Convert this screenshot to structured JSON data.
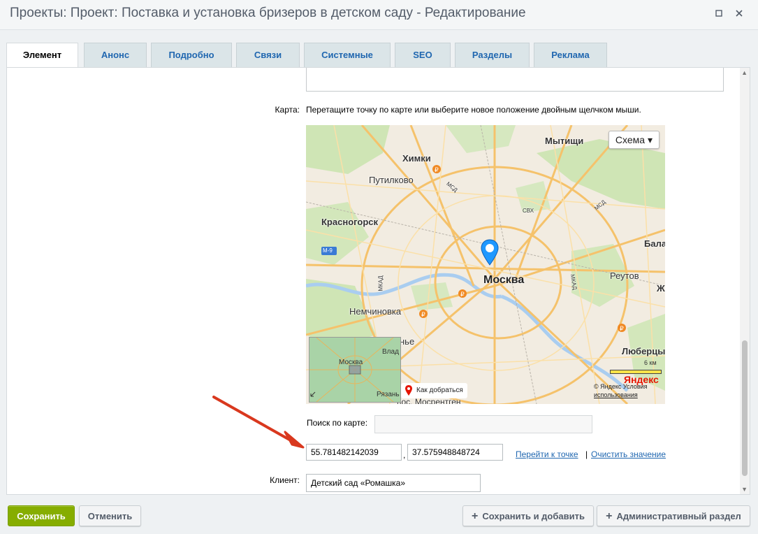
{
  "window": {
    "title": "Проекты: Проект: Поставка и установка бризеров в детском саду - Редактирование",
    "maximize_icon": "maximize-icon",
    "close_icon": "close-icon"
  },
  "tabs": [
    {
      "label": "Элемент",
      "active": true
    },
    {
      "label": "Анонс"
    },
    {
      "label": "Подробно"
    },
    {
      "label": "Связи"
    },
    {
      "label": "Системные"
    },
    {
      "label": "SEO"
    },
    {
      "label": "Разделы"
    },
    {
      "label": "Реклама"
    }
  ],
  "map_field": {
    "label": "Карта:",
    "hint": "Перетащите точку по карте или выберите новое положение двойным щелчком мыши."
  },
  "map": {
    "type_button": "Схема ▾",
    "labels": {
      "khimki": "Химки",
      "mytishchi": "Мытищи",
      "putilkovo": "Путилково",
      "krasnogorsk": "Красногорск",
      "moskva": "Москва",
      "reutov": "Реутов",
      "nemchinovka": "Немчиновка",
      "lyubertsy": "Люберцы",
      "bala": "Бала",
      "zh": "Ж",
      "nye": "нье",
      "mosrentgen": "пос. Мосрентген",
      "mkad_left": "МКАД",
      "mkad_right": "МКАД",
      "msd_top": "МСД",
      "msd_right": "МСД",
      "svh": "СВХ",
      "m9": "М-9"
    },
    "minimap": {
      "moskva": "Москва",
      "vlad": "Влад",
      "ryazan": "Рязань"
    },
    "route_label": "Как добраться",
    "scale": "6 км",
    "logo": "Яндекс",
    "copyright": "© Яндекс Условия",
    "copyright_link": "использования"
  },
  "search": {
    "label": "Поиск по карте:",
    "value": ""
  },
  "coords": {
    "lat": "55.781482142039",
    "lon": "37.575948848724",
    "separator": ",",
    "goto_link": "Перейти к точке",
    "divider": "|",
    "clear_link": "Очистить значение"
  },
  "client": {
    "label": "Клиент:",
    "value": "Детский сад «Ромашка»"
  },
  "footer": {
    "save": "Сохранить",
    "cancel": "Отменить",
    "save_add": "Сохранить и добавить",
    "admin": "Административный раздел"
  },
  "colors": {
    "accent": "#2067b0",
    "save_green": "#86ad00",
    "arrow_red": "#d9381e",
    "marker_blue": "#1e98ff"
  }
}
